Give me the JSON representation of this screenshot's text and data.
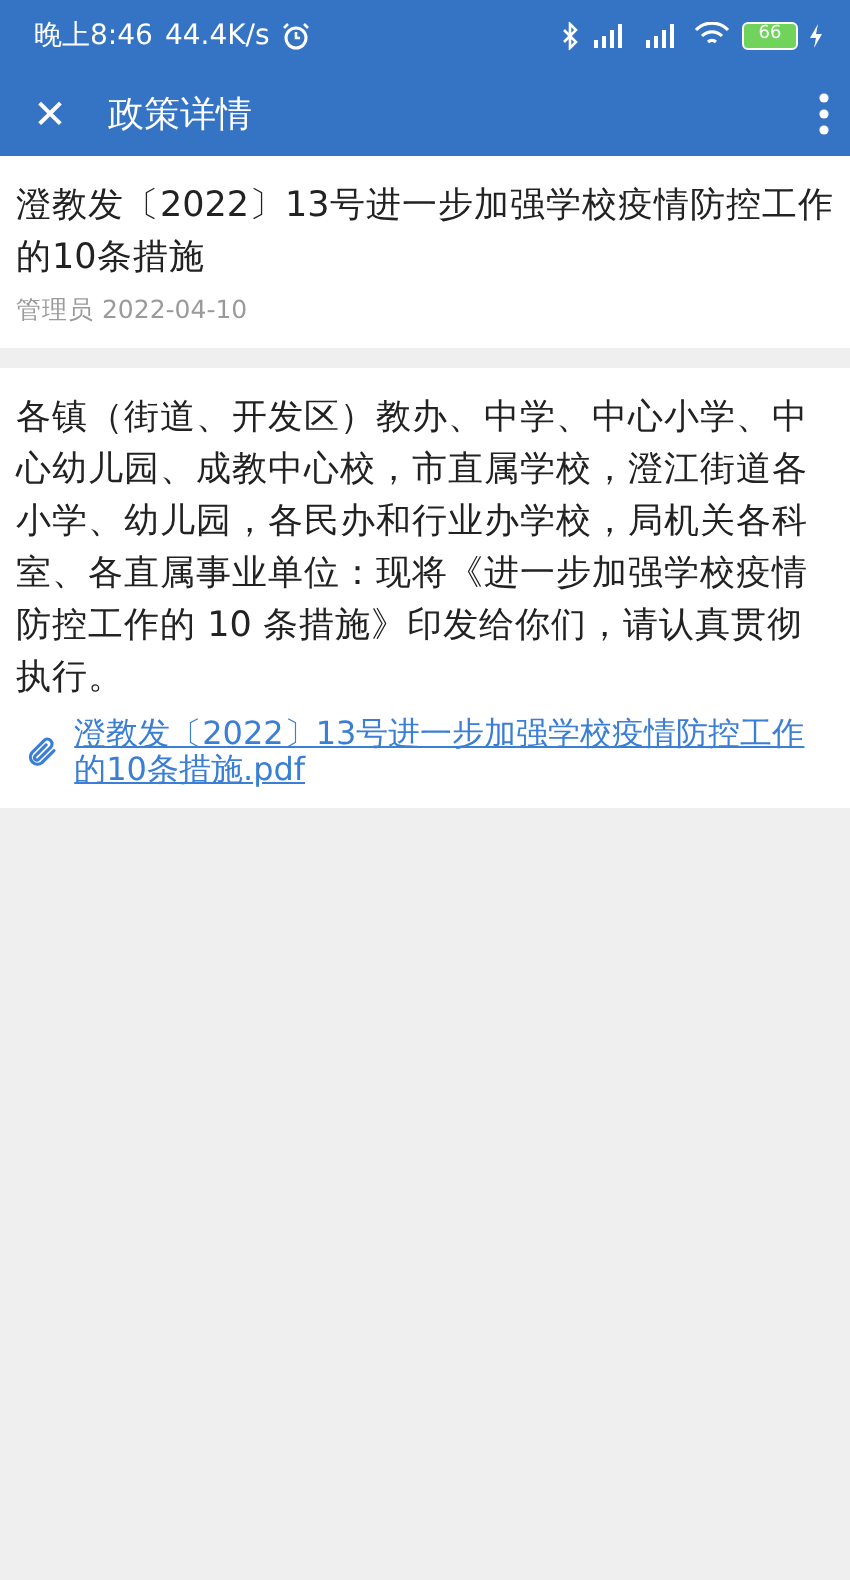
{
  "status_bar": {
    "time": "晚上8:46",
    "speed": "44.4K/s",
    "battery": "66"
  },
  "toolbar": {
    "close": "✕",
    "title": "政策详情"
  },
  "header": {
    "title": "澄教发〔2022〕13号进一步加强学校疫情防控工作的10条措施",
    "author": "管理员",
    "date": "2022-04-10"
  },
  "content": {
    "body": "各镇（街道、开发区）教办、中学、中心小学、中心幼儿园、成教中心校，市直属学校，澄江街道各小学、幼儿园，各民办和行业办学校，局机关各科室、各直属事业单位：现将《进一步加强学校疫情防控工作的 10 条措施》印发给你们，请认真贯彻执行。",
    "attachment": "澄教发〔2022〕13号进一步加强学校疫情防控工作的10条措施.pdf"
  }
}
